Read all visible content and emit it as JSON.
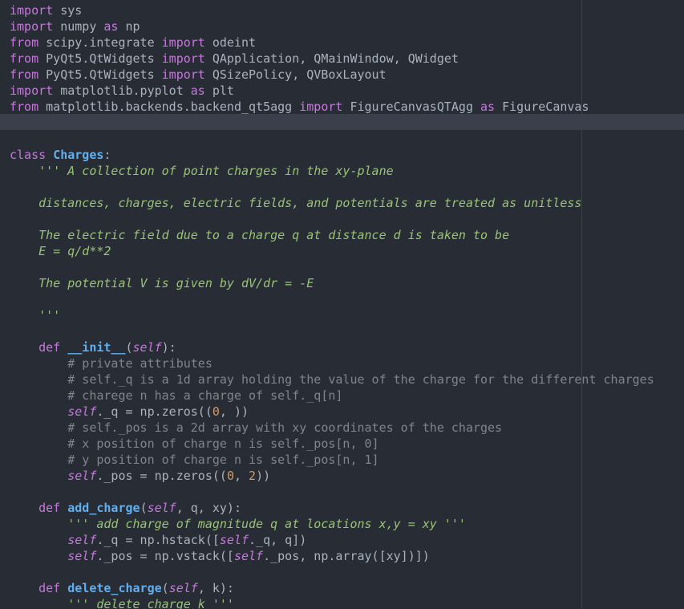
{
  "editor": {
    "theme_colors": {
      "background": "#282c34",
      "keyword": "#c678dd",
      "function": "#61afef",
      "docstring": "#98c379",
      "comment": "#7f848e",
      "number": "#d19a66",
      "text": "#abb2bf"
    },
    "lines": [
      [
        {
          "t": "import",
          "c": "kw"
        },
        {
          "t": " sys",
          "c": "plain"
        }
      ],
      [
        {
          "t": "import",
          "c": "kw"
        },
        {
          "t": " numpy ",
          "c": "plain"
        },
        {
          "t": "as",
          "c": "kw"
        },
        {
          "t": " np",
          "c": "plain"
        }
      ],
      [
        {
          "t": "from",
          "c": "kw"
        },
        {
          "t": " scipy.integrate ",
          "c": "plain"
        },
        {
          "t": "import",
          "c": "kw"
        },
        {
          "t": " odeint",
          "c": "plain"
        }
      ],
      [
        {
          "t": "from",
          "c": "kw"
        },
        {
          "t": " PyQt5.QtWidgets ",
          "c": "plain"
        },
        {
          "t": "import",
          "c": "kw"
        },
        {
          "t": " QApplication, QMainWindow, QWidget",
          "c": "plain"
        }
      ],
      [
        {
          "t": "from",
          "c": "kw"
        },
        {
          "t": " PyQt5.QtWidgets ",
          "c": "plain"
        },
        {
          "t": "import",
          "c": "kw"
        },
        {
          "t": " QSizePolicy, QVBoxLayout",
          "c": "plain"
        }
      ],
      [
        {
          "t": "import",
          "c": "kw"
        },
        {
          "t": " matplotlib.pyplot ",
          "c": "plain"
        },
        {
          "t": "as",
          "c": "kw"
        },
        {
          "t": " plt",
          "c": "plain"
        }
      ],
      [
        {
          "t": "from",
          "c": "kw"
        },
        {
          "t": " matplotlib.backends.backend_qt5agg ",
          "c": "plain"
        },
        {
          "t": "import",
          "c": "kw"
        },
        {
          "t": " FigureCanvasQTAgg ",
          "c": "plain"
        },
        {
          "t": "as",
          "c": "kw"
        },
        {
          "t": " FigureCanvas",
          "c": "plain"
        }
      ],
      [],
      [],
      [
        {
          "t": "class",
          "c": "kw"
        },
        {
          "t": " ",
          "c": "plain"
        },
        {
          "t": "Charges",
          "c": "cls"
        },
        {
          "t": ":",
          "c": "plain"
        }
      ],
      [
        {
          "t": "    ''' A collection of point charges in the xy-plane",
          "c": "doc"
        }
      ],
      [],
      [
        {
          "t": "    distances, charges, electric fields, and potentials are treated as unitless",
          "c": "doc"
        }
      ],
      [],
      [
        {
          "t": "    The electric field due to a charge q at distance d is taken to be",
          "c": "doc"
        }
      ],
      [
        {
          "t": "    E = q/d**2",
          "c": "doc"
        }
      ],
      [],
      [
        {
          "t": "    The potential V is given by dV/dr = -E",
          "c": "doc"
        }
      ],
      [],
      [
        {
          "t": "    '''",
          "c": "doc"
        }
      ],
      [],
      [
        {
          "t": "    ",
          "c": "plain"
        },
        {
          "t": "def",
          "c": "kw"
        },
        {
          "t": " ",
          "c": "plain"
        },
        {
          "t": "__init__",
          "c": "fn"
        },
        {
          "t": "(",
          "c": "plain"
        },
        {
          "t": "self",
          "c": "self"
        },
        {
          "t": "):",
          "c": "plain"
        }
      ],
      [
        {
          "t": "        # private attributes",
          "c": "cmt"
        }
      ],
      [
        {
          "t": "        # self._q is a 1d array holding the value of the charge for the different charges",
          "c": "cmt"
        }
      ],
      [
        {
          "t": "        # charege n has a charge of self._q[n]",
          "c": "cmt"
        }
      ],
      [
        {
          "t": "        ",
          "c": "plain"
        },
        {
          "t": "self",
          "c": "self"
        },
        {
          "t": "._q = np.zeros((",
          "c": "plain"
        },
        {
          "t": "0",
          "c": "num"
        },
        {
          "t": ", ))",
          "c": "plain"
        }
      ],
      [
        {
          "t": "        # self._pos is a 2d array with xy coordinates of the charges",
          "c": "cmt"
        }
      ],
      [
        {
          "t": "        # x position of charge n is self._pos[n, 0]",
          "c": "cmt"
        }
      ],
      [
        {
          "t": "        # y position of charge n is self._pos[n, 1]",
          "c": "cmt"
        }
      ],
      [
        {
          "t": "        ",
          "c": "plain"
        },
        {
          "t": "self",
          "c": "self"
        },
        {
          "t": "._pos = np.zeros((",
          "c": "plain"
        },
        {
          "t": "0",
          "c": "num"
        },
        {
          "t": ", ",
          "c": "plain"
        },
        {
          "t": "2",
          "c": "num"
        },
        {
          "t": "))",
          "c": "plain"
        }
      ],
      [],
      [
        {
          "t": "    ",
          "c": "plain"
        },
        {
          "t": "def",
          "c": "kw"
        },
        {
          "t": " ",
          "c": "plain"
        },
        {
          "t": "add_charge",
          "c": "fn"
        },
        {
          "t": "(",
          "c": "plain"
        },
        {
          "t": "self",
          "c": "self"
        },
        {
          "t": ", q, xy):",
          "c": "plain"
        }
      ],
      [
        {
          "t": "        ''' add charge of magnitude q at locations x,y = xy '''",
          "c": "doc"
        }
      ],
      [
        {
          "t": "        ",
          "c": "plain"
        },
        {
          "t": "self",
          "c": "self"
        },
        {
          "t": "._q = np.hstack([",
          "c": "plain"
        },
        {
          "t": "self",
          "c": "self"
        },
        {
          "t": "._q, q])",
          "c": "plain"
        }
      ],
      [
        {
          "t": "        ",
          "c": "plain"
        },
        {
          "t": "self",
          "c": "self"
        },
        {
          "t": "._pos = np.vstack([",
          "c": "plain"
        },
        {
          "t": "self",
          "c": "self"
        },
        {
          "t": "._pos, np.array([xy])])",
          "c": "plain"
        }
      ],
      [],
      [
        {
          "t": "    ",
          "c": "plain"
        },
        {
          "t": "def",
          "c": "kw"
        },
        {
          "t": " ",
          "c": "plain"
        },
        {
          "t": "delete_charge",
          "c": "fn"
        },
        {
          "t": "(",
          "c": "plain"
        },
        {
          "t": "self",
          "c": "self"
        },
        {
          "t": ", k):",
          "c": "plain"
        }
      ],
      [
        {
          "t": "        ''' delete charge k '''",
          "c": "doc"
        }
      ]
    ]
  }
}
